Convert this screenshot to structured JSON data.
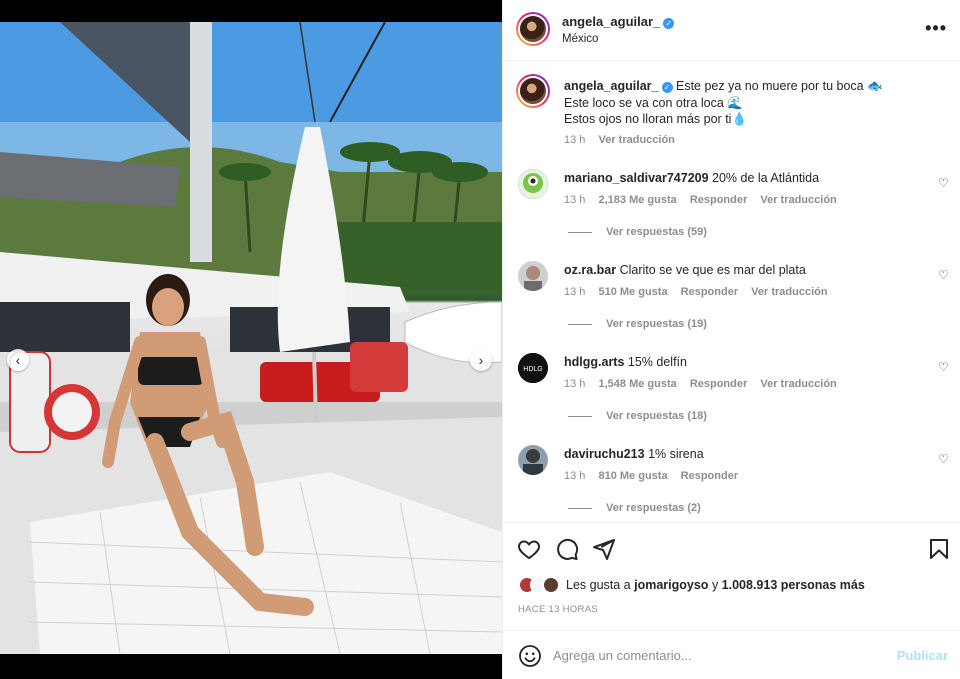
{
  "post": {
    "author": "angela_aguilar_",
    "location": "México"
  },
  "media": {
    "prev_label": "‹",
    "next_label": "›"
  },
  "caption": {
    "username": "angela_aguilar_",
    "line1": "Este pez ya no muere por tu boca 🐟",
    "line2": "Este loco se va con otra loca 🌊",
    "line3": "Estos ojos no lloran más por ti💧",
    "time": "13 h",
    "translate": "Ver traducción"
  },
  "comments": [
    {
      "username": "mariano_saldivar747209",
      "text": "20% de la Atlántida",
      "time": "13 h",
      "likes": "2,183 Me gusta",
      "reply": "Responder",
      "translate": "Ver traducción",
      "replies": "Ver respuestas (59)",
      "avatar_color": "#2e7d32"
    },
    {
      "username": "oz.ra.bar",
      "text": "Clarito se ve que es mar del plata",
      "time": "13 h",
      "likes": "510 Me gusta",
      "reply": "Responder",
      "translate": "Ver traducción",
      "replies": "Ver respuestas (19)",
      "avatar_color": "#9e9e9e"
    },
    {
      "username": "hdlgg.arts",
      "text": "15% delfín",
      "time": "13 h",
      "likes": "1,548 Me gusta",
      "reply": "Responder",
      "translate": "Ver traducción",
      "replies": "Ver respuestas (18)",
      "avatar_color": "#111111"
    },
    {
      "username": "daviruchu213",
      "text": "1% sirena",
      "time": "13 h",
      "likes": "810 Me gusta",
      "reply": "Responder",
      "replies": "Ver respuestas (2)",
      "avatar_color": "#5d6d7e"
    }
  ],
  "likes_summary": {
    "prefix": "Les gusta a",
    "user": "jomarigoyso",
    "middle": "y",
    "count": "1.008.913 personas más"
  },
  "time_ago": "HACE 13 HORAS",
  "add_comment": {
    "placeholder": "Agrega un comentario...",
    "publish": "Publicar"
  },
  "colors": {
    "verified": "#3897f0",
    "publish_disabled": "#b2dffc",
    "secondary_text": "#8e8e8e"
  },
  "icons": [
    "more-icon",
    "verified-icon",
    "heart-icon",
    "comment-icon",
    "share-icon",
    "bookmark-icon",
    "emoji-icon",
    "chevron-left-icon",
    "chevron-right-icon"
  ]
}
